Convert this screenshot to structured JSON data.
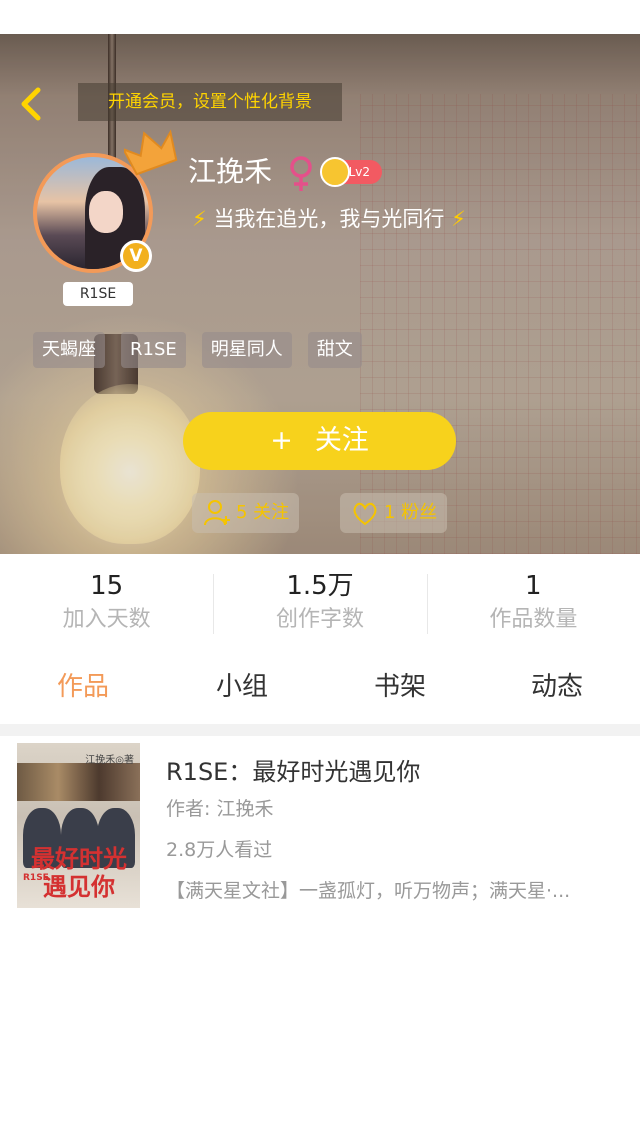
{
  "header": {
    "vip_banner": "开通会员，设置个性化背景",
    "username": "江挽禾",
    "level": "Lv2",
    "signature": "当我在追光，我与光同行",
    "signature_bolt": "⚡",
    "avatar_badge": "R1SE",
    "verified": "V",
    "tags": [
      "天蝎座",
      "R1SE",
      "明星同人",
      "甜文"
    ],
    "follow_button": {
      "plus": "+",
      "label": "关注"
    },
    "following": "5 关注",
    "fans": "1 粉丝"
  },
  "stats": [
    {
      "value": "15",
      "label": "加入天数"
    },
    {
      "value": "1.5万",
      "label": "创作字数"
    },
    {
      "value": "1",
      "label": "作品数量"
    }
  ],
  "tabs": [
    {
      "label": "作品",
      "active": true
    },
    {
      "label": "小组",
      "active": false
    },
    {
      "label": "书架",
      "active": false
    },
    {
      "label": "动态",
      "active": false
    }
  ],
  "works": [
    {
      "title": "R1SE：最好时光遇见你",
      "author": "作者: 江挽禾",
      "views": "2.8万人看过",
      "description": "【满天星文社】一盏孤灯，听万物声；满天星·...",
      "cover": {
        "title": "最好时光遇见你",
        "author": "江挽禾◎著",
        "brand": "R1SE"
      }
    }
  ],
  "colors": {
    "accent": "#f39a58",
    "follow_yellow": "#f7d21c",
    "vip_text": "#ffd400",
    "level_badge": "#f25a62"
  },
  "icons": [
    "back-arrow-icon",
    "crown-icon",
    "female-icon",
    "follow-user-icon",
    "heart-icon",
    "verified-icon"
  ]
}
